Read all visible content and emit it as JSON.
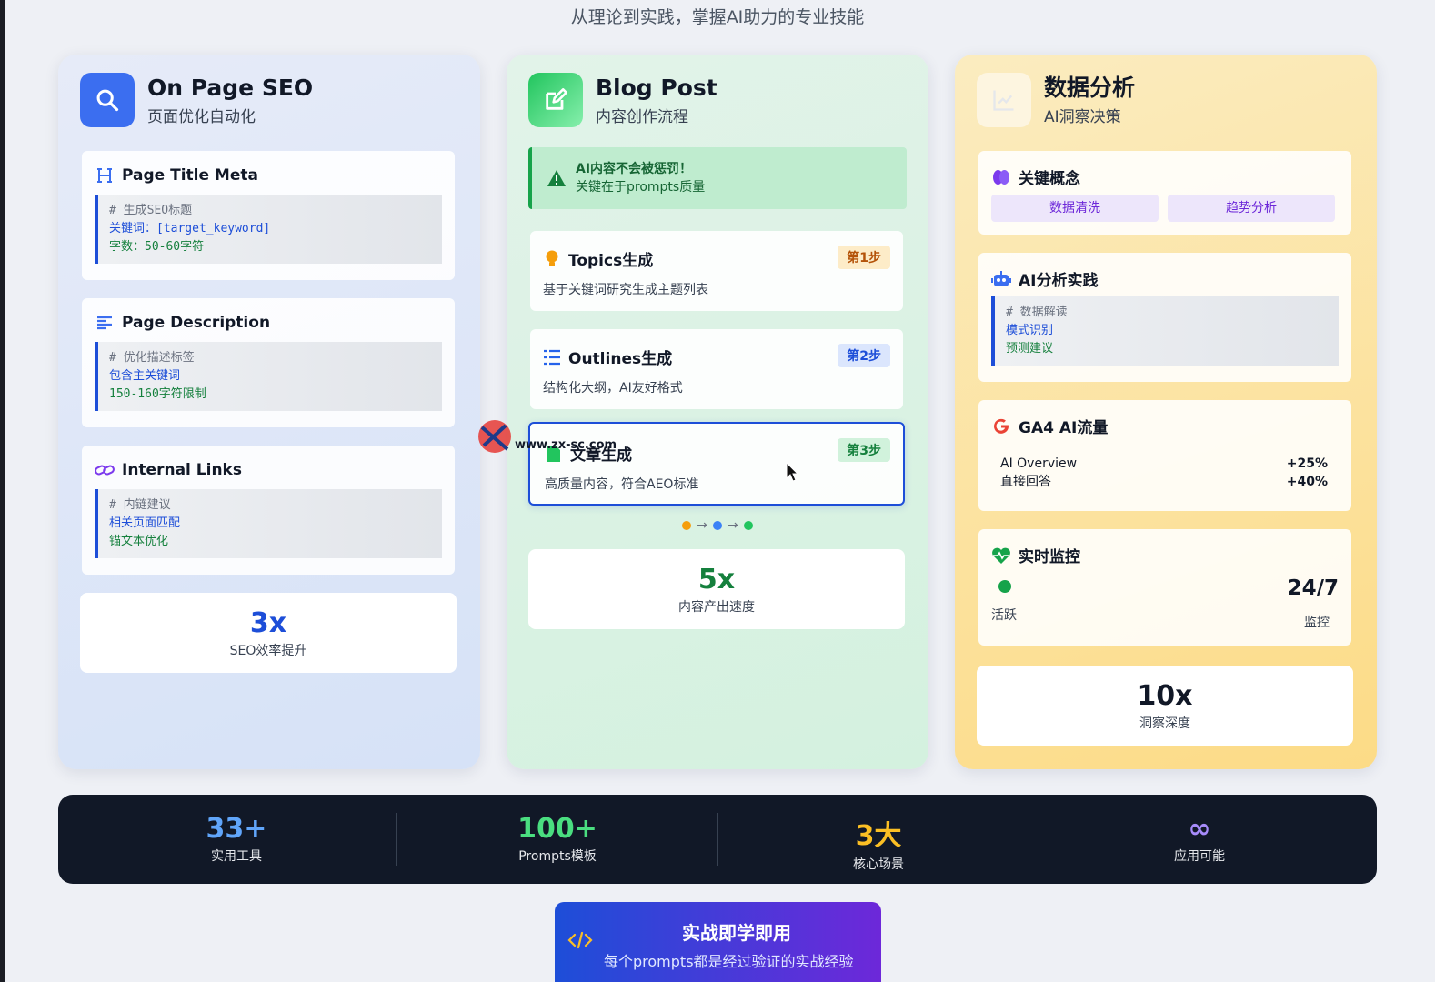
{
  "subtitle": "从理论到实践，掌握AI助力的专业技能",
  "colors": {
    "seo_blue": "#3b6ef0",
    "blog_green": "#22c55e",
    "data_orange": "#f59e0b",
    "dark_bar": "#111827"
  },
  "seo": {
    "title": "On Page SEO",
    "subtitle": "页面优化自动化",
    "icon": "search-icon",
    "panels": [
      {
        "title": "Page Title Meta",
        "icon": "heading-icon",
        "lines": [
          "# 生成SEO标题",
          "关键词：[target_keyword]",
          "字数：50-60字符"
        ]
      },
      {
        "title": "Page Description",
        "icon": "align-left-icon",
        "lines": [
          "# 优化描述标签",
          "包含主关键词",
          "150-160字符限制"
        ]
      },
      {
        "title": "Internal Links",
        "icon": "link-icon",
        "lines": [
          "# 内链建议",
          "相关页面匹配",
          "锚文本优化"
        ]
      }
    ],
    "stat": {
      "value": "3x",
      "label": "SEO效率提升"
    }
  },
  "blog": {
    "title": "Blog Post",
    "subtitle": "内容创作流程",
    "icon": "edit-icon",
    "alert": {
      "line1": "AI内容不会被惩罚！",
      "line2": "关键在于prompts质量"
    },
    "steps": [
      {
        "title": "Topics生成",
        "badge": "第1步",
        "desc": "基于关键词研究生成主题列表",
        "icon": "lightbulb-icon"
      },
      {
        "title": "Outlines生成",
        "badge": "第2步",
        "desc": "结构化大纲，AI友好格式",
        "icon": "list-icon"
      },
      {
        "title": "文章生成",
        "badge": "第3步",
        "desc": "高质量内容，符合AEO标准",
        "icon": "file-icon"
      }
    ],
    "stat": {
      "value": "5x",
      "label": "内容产出速度"
    }
  },
  "data": {
    "title": "数据分析",
    "subtitle": "AI洞察决策",
    "icon": "chart-icon",
    "concepts": {
      "title": "关键概念",
      "chips": [
        "数据清洗",
        "趋势分析"
      ]
    },
    "practice": {
      "title": "AI分析实践",
      "lines": [
        "# 数据解读",
        "模式识别",
        "预测建议"
      ]
    },
    "ga4": {
      "title": "GA4 AI流量",
      "rows": [
        {
          "label": "AI Overview",
          "value": "+25%"
        },
        {
          "label": "直接回答",
          "value": "+40%"
        }
      ]
    },
    "monitor": {
      "title": "实时监控",
      "status": "活跃",
      "value": "24/7",
      "value_label": "监控"
    },
    "stat": {
      "value": "10x",
      "label": "洞察深度"
    }
  },
  "stats_bar": [
    {
      "value": "33+",
      "label": "实用工具",
      "color": "#60a5fa"
    },
    {
      "value": "100+",
      "label": "Prompts模板",
      "color": "#4ade80"
    },
    {
      "value": "3大",
      "label": "核心场景",
      "color": "#fbbf24"
    },
    {
      "value": "∞",
      "label": "应用可能",
      "color": "#a78bfa"
    }
  ],
  "cta": {
    "title": "实战即学即用",
    "subtitle": "每个prompts都是经过验证的实战经验"
  },
  "watermark": {
    "text": "www.zx-sc.com"
  }
}
